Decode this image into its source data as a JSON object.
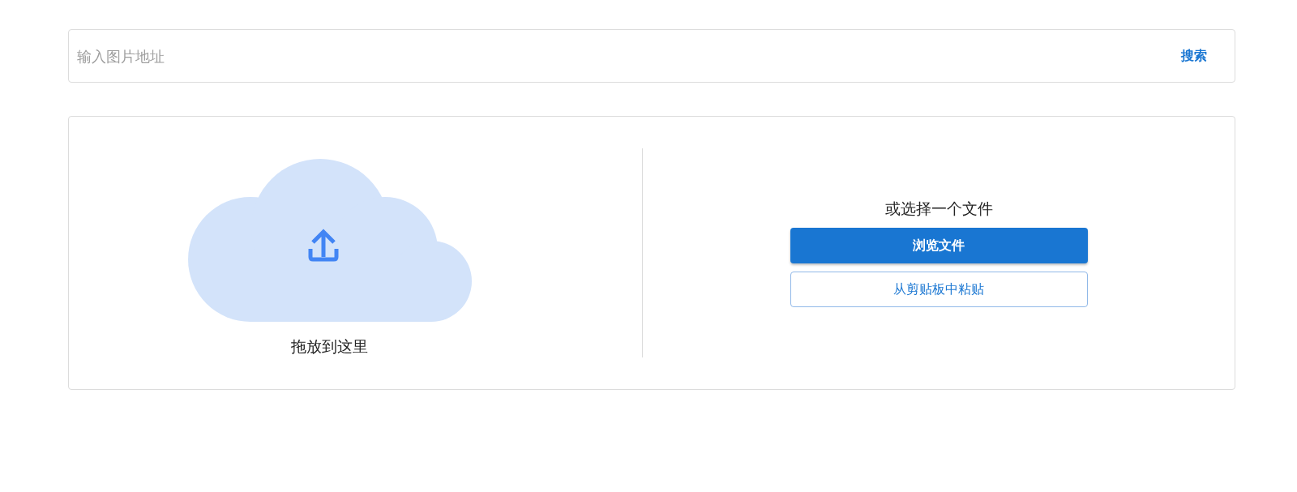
{
  "search": {
    "placeholder": "输入图片地址",
    "button": "搜索"
  },
  "drop_zone": {
    "label": "拖放到这里"
  },
  "file_picker": {
    "prompt": "或选择一个文件",
    "buttons": [
      {
        "label": "浏览文件",
        "kind": "primary"
      },
      {
        "label": "从剪贴板中粘贴",
        "kind": "outlined"
      }
    ]
  }
}
